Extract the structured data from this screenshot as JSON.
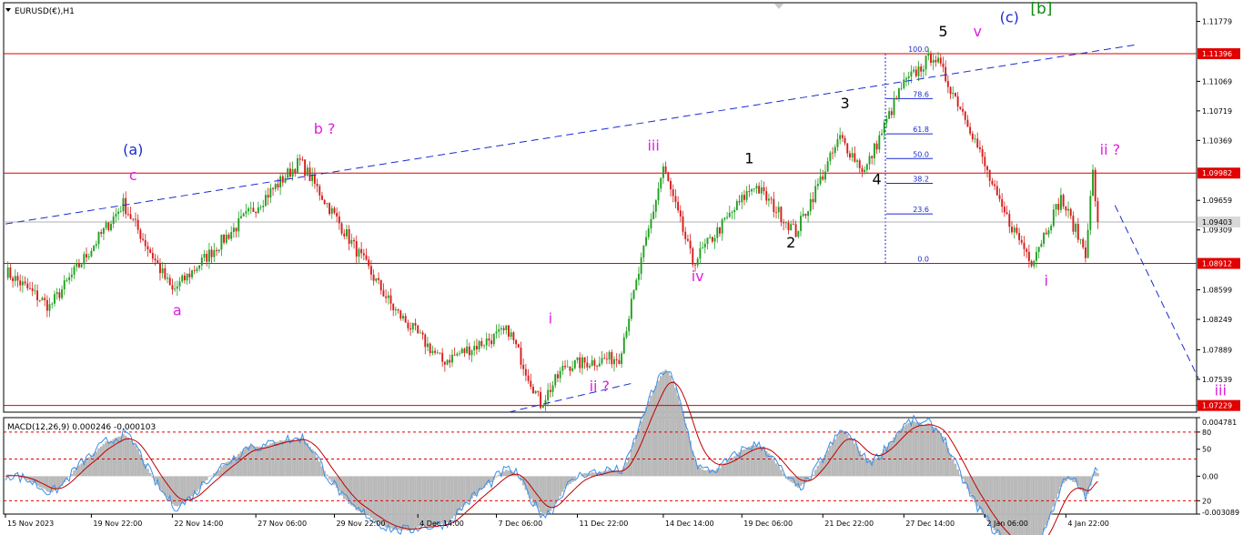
{
  "window": {
    "title": "EURUSD(€),H1"
  },
  "macd_title": "MACD(12,26,9) 0.000246 -0.000103",
  "colors": {
    "bull": "#1fa01f",
    "bear": "#d81b1b",
    "hline": "#e00000",
    "trend": "#1a2bd0",
    "wave_magenta": "#e020e0",
    "wave_blue": "#1a2bd0",
    "wave_green": "#108a10",
    "macd_line": "#3a8ee8",
    "signal_line": "#c00000",
    "hist": "#b9b9b9",
    "price_badge": "#d8d8d8"
  },
  "chart_data": {
    "type": "candlestick",
    "symbol": "EURUSD",
    "timeframe": "H1",
    "ylim": [
      1.0715,
      1.12
    ],
    "price_ticks": [
      "1.11779",
      "1.11069",
      "1.10719",
      "1.10369",
      "1.09659",
      "1.09309",
      "1.08599",
      "1.08249",
      "1.07889",
      "1.07539",
      "1.07229"
    ],
    "price_tick_values": [
      1.11779,
      1.11069,
      1.10719,
      1.10369,
      1.09659,
      1.09309,
      1.08599,
      1.08249,
      1.07889,
      1.07539,
      1.07229
    ],
    "time_labels": [
      "15 Nov 2023",
      "19 Nov 22:00",
      "22 Nov 14:00",
      "27 Nov 06:00",
      "29 Nov 22:00",
      "4 Dec 14:00",
      "7 Dec 06:00",
      "11 Dec 22:00",
      "14 Dec 14:00",
      "19 Dec 06:00",
      "21 Dec 22:00",
      "27 Dec 14:00",
      "2 Jan 06:00",
      "4 Jan 22:00"
    ],
    "time_label_index": [
      0,
      35,
      68,
      102,
      134,
      168,
      200,
      233,
      268,
      300,
      333,
      366,
      399,
      432
    ],
    "bar_count": 445,
    "pivots": [
      [
        0,
        1.0882
      ],
      [
        18,
        1.084
      ],
      [
        48,
        1.0962
      ],
      [
        68,
        1.0858
      ],
      [
        120,
        1.1012
      ],
      [
        158,
        1.0838
      ],
      [
        178,
        1.0775
      ],
      [
        205,
        1.0812
      ],
      [
        218,
        1.0725
      ],
      [
        228,
        1.077
      ],
      [
        250,
        1.078
      ],
      [
        268,
        1.1005
      ],
      [
        280,
        1.0892
      ],
      [
        305,
        1.0985
      ],
      [
        322,
        1.0928
      ],
      [
        340,
        1.104
      ],
      [
        350,
        1.1
      ],
      [
        365,
        1.11
      ],
      [
        378,
        1.1139
      ],
      [
        392,
        1.106
      ],
      [
        405,
        1.096
      ],
      [
        418,
        1.0895
      ],
      [
        430,
        1.0968
      ],
      [
        440,
        1.0905
      ],
      [
        443,
        1.0998
      ],
      [
        445,
        1.094
      ]
    ],
    "hlines": [
      {
        "price": 1.11396,
        "label": "1.11396"
      },
      {
        "price": 1.09982,
        "label": "1.09982"
      },
      {
        "price": 1.08912,
        "label": "1.08912"
      },
      {
        "price": 1.07229,
        "label": "1.07229"
      }
    ],
    "current_price": {
      "price": 1.09403,
      "label": "1.09403"
    },
    "fibonacci": {
      "high": 1.11396,
      "low": 1.08912,
      "levels": [
        {
          "ratio": 1.0,
          "label": "100.0"
        },
        {
          "ratio": 0.786,
          "label": "78.6"
        },
        {
          "ratio": 0.618,
          "label": "61.8"
        },
        {
          "ratio": 0.5,
          "label": "50.0"
        },
        {
          "ratio": 0.382,
          "label": "38.2"
        },
        {
          "ratio": 0.236,
          "label": "23.6"
        },
        {
          "ratio": 0.0,
          "label": "0.0"
        }
      ]
    },
    "trendlines": [
      {
        "from": [
          0,
          1.0938
        ],
        "to": [
          460,
          1.115
        ],
        "style": "dashed"
      },
      {
        "from": [
          205,
          1.0715
        ],
        "to": [
          255,
          1.0749
        ],
        "style": "dashed"
      },
      {
        "from": [
          452,
          1.096
        ],
        "to": [
          486,
          1.0755
        ],
        "style": "dashed"
      }
    ],
    "wave_labels": [
      {
        "text": "(a)",
        "bar": 52,
        "price": 1.102,
        "color": "wave_blue"
      },
      {
        "text": "c",
        "bar": 52,
        "price": 1.099,
        "color": "wave_magenta"
      },
      {
        "text": "a",
        "bar": 70,
        "price": 1.083,
        "color": "wave_magenta"
      },
      {
        "text": "b ?",
        "bar": 130,
        "price": 1.1045,
        "color": "wave_magenta"
      },
      {
        "text": "i",
        "bar": 222,
        "price": 1.082,
        "color": "wave_magenta"
      },
      {
        "text": "ii ?",
        "bar": 242,
        "price": 1.074,
        "color": "wave_magenta"
      },
      {
        "text": "iii",
        "bar": 264,
        "price": 1.1025,
        "color": "wave_magenta"
      },
      {
        "text": "iv",
        "bar": 282,
        "price": 1.087,
        "color": "wave_magenta"
      },
      {
        "text": "1",
        "bar": 303,
        "price": 1.101,
        "color": "black"
      },
      {
        "text": "2",
        "bar": 320,
        "price": 1.091,
        "color": "black"
      },
      {
        "text": "3",
        "bar": 342,
        "price": 1.1075,
        "color": "black"
      },
      {
        "text": "4",
        "bar": 355,
        "price": 1.0985,
        "color": "black"
      },
      {
        "text": "5",
        "bar": 382,
        "price": 1.116,
        "color": "black"
      },
      {
        "text": "v",
        "bar": 396,
        "price": 1.116,
        "color": "wave_magenta"
      },
      {
        "text": "(c)",
        "bar": 409,
        "price": 1.1177,
        "color": "wave_blue"
      },
      {
        "text": "[b]",
        "bar": 422,
        "price": 1.1187,
        "color": "wave_green"
      },
      {
        "text": "i",
        "bar": 424,
        "price": 1.0865,
        "color": "wave_magenta"
      },
      {
        "text": "ii ?",
        "bar": 450,
        "price": 1.102,
        "color": "wave_magenta"
      },
      {
        "text": "iii",
        "bar": 495,
        "price": 1.0735,
        "color": "wave_magenta"
      }
    ],
    "macd": {
      "title": "MACD(12,26,9) 0.000246 -0.000103",
      "ylim": [
        -0.00309,
        0.00478
      ],
      "ticks": [
        "0.004781",
        "80",
        "50",
        "0.00",
        "20",
        "-0.003089"
      ],
      "tick_values": [
        0.004781,
        0.0036,
        0.0022,
        0.0,
        -0.002,
        -0.003089
      ],
      "dashed_levels": [
        0.0036,
        0.0014,
        -0.002
      ],
      "main_value": 0.000246,
      "signal_value": -0.000103
    }
  }
}
